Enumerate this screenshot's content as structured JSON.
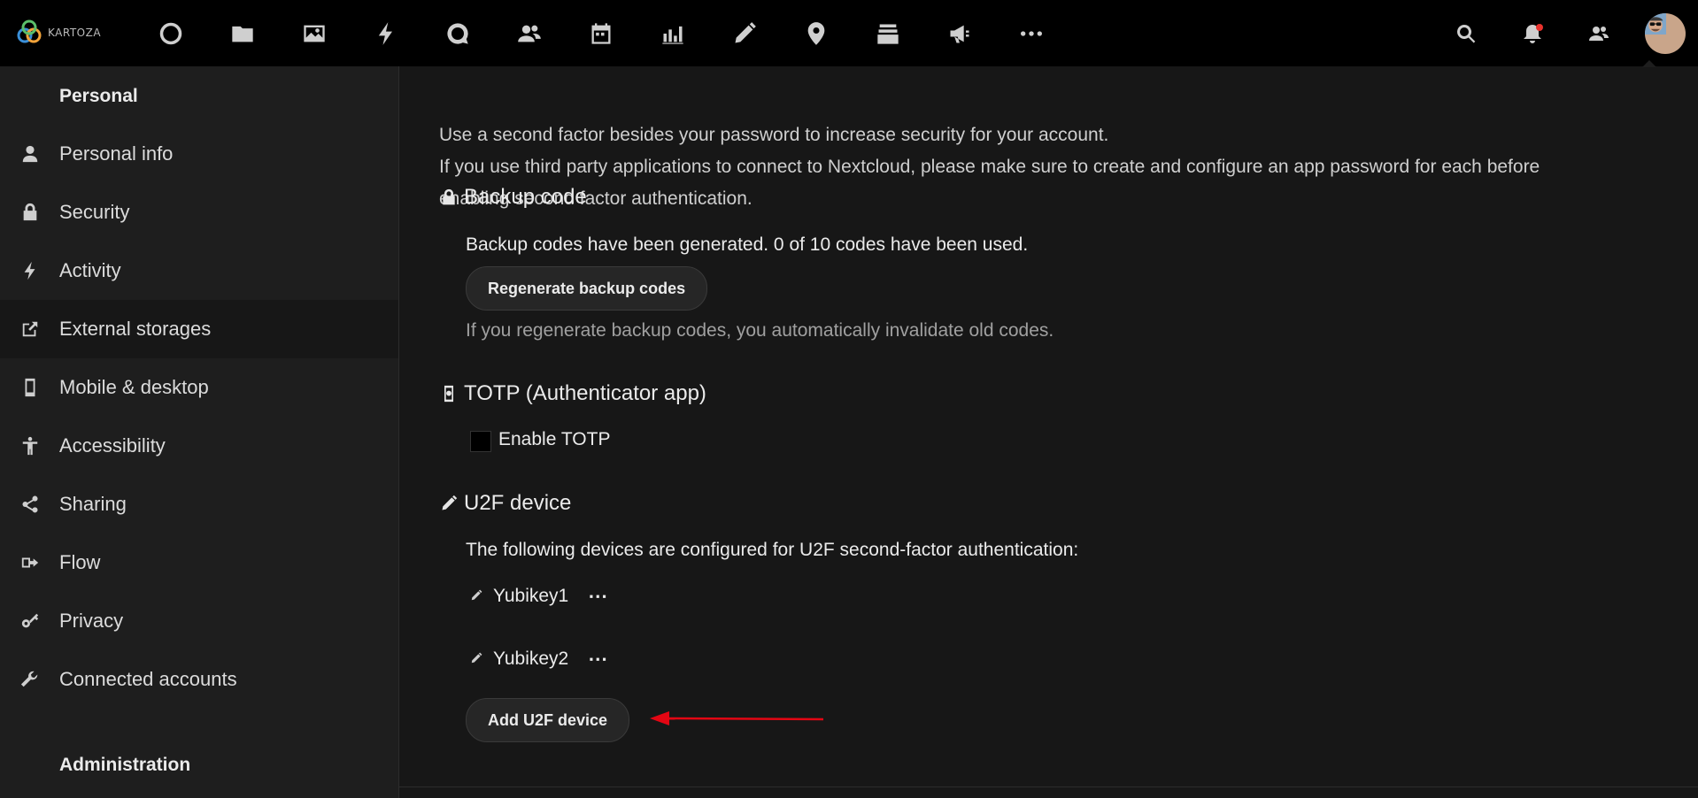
{
  "header": {
    "logo_text": "KARTOZA",
    "apps": [
      "dashboard-icon",
      "files-icon",
      "photos-icon",
      "activity-icon",
      "talk-icon",
      "contacts-icon",
      "calendar-icon",
      "analytics-icon",
      "notes-icon",
      "maps-icon",
      "deck-icon",
      "announcements-icon",
      "more-apps-icon"
    ],
    "right": [
      "search-icon",
      "notifications-icon",
      "contacts-menu-icon",
      "avatar"
    ]
  },
  "sidebar": {
    "personal_heading": "Personal",
    "items": [
      {
        "label": "Personal info",
        "icon": "user-icon"
      },
      {
        "label": "Security",
        "icon": "lock-icon"
      },
      {
        "label": "Activity",
        "icon": "activity-icon"
      },
      {
        "label": "External storages",
        "icon": "external-icon"
      },
      {
        "label": "Mobile & desktop",
        "icon": "phone-icon"
      },
      {
        "label": "Accessibility",
        "icon": "accessibility-icon"
      },
      {
        "label": "Sharing",
        "icon": "share-icon"
      },
      {
        "label": "Flow",
        "icon": "flow-icon"
      },
      {
        "label": "Privacy",
        "icon": "key-icon"
      },
      {
        "label": "Connected accounts",
        "icon": "wrench-icon"
      }
    ],
    "admin_heading": "Administration"
  },
  "main": {
    "intro_line1": "Use a second factor besides your password to increase security for your account.",
    "intro_line2": "If you use third party applications to connect to Nextcloud, please make sure to create and configure an app password for each before",
    "intro_line3": "enabling second factor authentication.",
    "backup": {
      "title": "Backup code",
      "status": "Backup codes have been generated. 0 of 10 codes have been used.",
      "regenerate_label": "Regenerate backup codes",
      "hint": "If you regenerate backup codes, you automatically invalidate old codes."
    },
    "totp": {
      "title": "TOTP (Authenticator app)",
      "checkbox_label": "Enable TOTP"
    },
    "u2f": {
      "title": "U2F device",
      "description": "The following devices are configured for U2F second-factor authentication:",
      "devices": [
        {
          "name": "Yubikey1",
          "menu": "⋯"
        },
        {
          "name": "Yubikey2",
          "menu": "⋯"
        }
      ],
      "add_label": "Add U2F device"
    }
  },
  "colors": {
    "annotation_arrow": "#e30613"
  }
}
